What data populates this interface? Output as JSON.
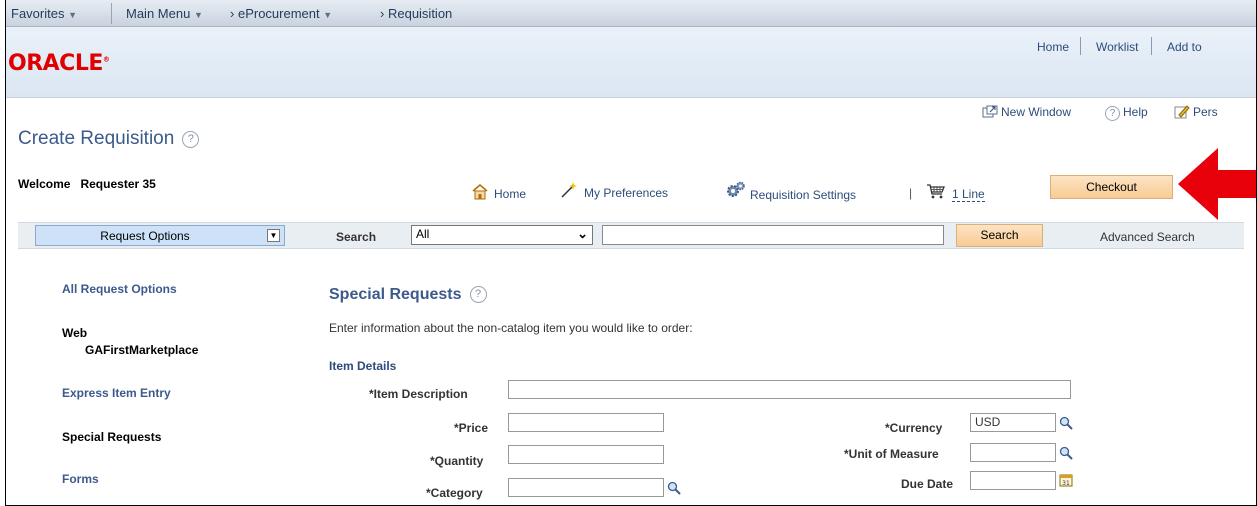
{
  "topnav": {
    "favorites": "Favorites",
    "main_menu": "Main Menu",
    "eprocurement": "eProcurement",
    "requisition": "Requisition"
  },
  "logo": "ORACLE",
  "header_links": {
    "home": "Home",
    "worklist": "Worklist",
    "add_to": "Add to"
  },
  "utility_links": {
    "new_window": "New Window",
    "help": "Help",
    "personalize": "Pers"
  },
  "page": {
    "title": "Create Requisition",
    "welcome_label": "Welcome",
    "user": "Requester 35"
  },
  "requisition_nav": {
    "home": "Home",
    "my_preferences": "My Preferences",
    "requisition_settings": "Requisition Settings",
    "separator": "|",
    "cart_lines": "1 Line",
    "checkout": "Checkout"
  },
  "search_bar": {
    "request_options": "Request Options",
    "search_label": "Search",
    "scope_value": "All",
    "query_value": "",
    "search_button": "Search",
    "advanced_search": "Advanced Search"
  },
  "sidebar": {
    "items": [
      {
        "label": "All Request Options",
        "style": "link"
      },
      {
        "label": "Web",
        "style": "plain"
      },
      {
        "label": "GAFirstMarketplace",
        "style": "plain"
      },
      {
        "label": "Express Item Entry",
        "style": "link"
      },
      {
        "label": "Special Requests",
        "style": "plain"
      },
      {
        "label": "Forms",
        "style": "link"
      }
    ]
  },
  "special_requests": {
    "title": "Special Requests",
    "intro": "Enter information about the non-catalog item you would like to order:",
    "item_details": "Item Details",
    "fields": {
      "item_description": {
        "label": "*Item Description",
        "value": ""
      },
      "price": {
        "label": "*Price",
        "value": ""
      },
      "quantity": {
        "label": "*Quantity",
        "value": ""
      },
      "category": {
        "label": "*Category",
        "value": ""
      },
      "currency": {
        "label": "*Currency",
        "value": "USD"
      },
      "unit_of_measure": {
        "label": "*Unit of Measure",
        "value": ""
      },
      "due_date": {
        "label": "Due Date",
        "value": ""
      }
    }
  },
  "colors": {
    "accent_red": "#e00000",
    "link_blue": "#3c5a8c",
    "button_orange": "#f8cb95"
  }
}
